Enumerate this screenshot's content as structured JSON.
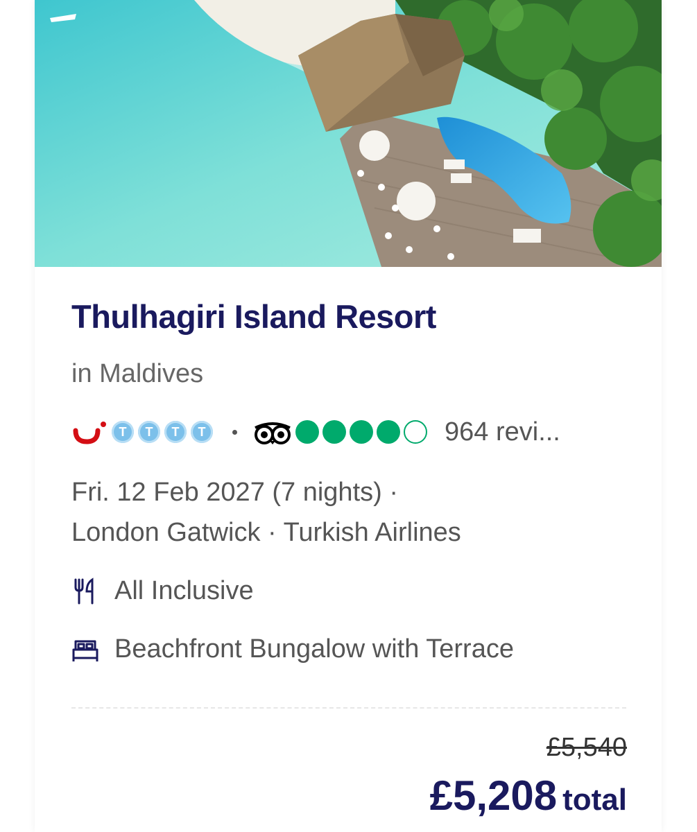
{
  "hotel": {
    "name": "Thulhagiri Island Resort",
    "location": "in Maldives"
  },
  "ratings": {
    "tui_rating": 4,
    "tui_glyph": "T",
    "tripadvisor_rating": 4,
    "tripadvisor_max": 5,
    "review_count": "964 revi..."
  },
  "trip": {
    "date_line": "Fri. 12 Feb 2027 (7 nights) ·",
    "route_line": "London Gatwick · Turkish Airlines"
  },
  "features": {
    "board": "All Inclusive",
    "board_icon": "cutlery-icon",
    "room": "Beachfront Bungalow with Terrace",
    "room_icon": "bed-icon"
  },
  "price": {
    "original": "£5,540",
    "total": "£5,208",
    "suffix": "total"
  },
  "colors": {
    "title": "#1a1a5e",
    "tui_red": "#d40e14",
    "tui_blue": "#7cc0ea",
    "tripadvisor_green": "#00aa6c"
  }
}
